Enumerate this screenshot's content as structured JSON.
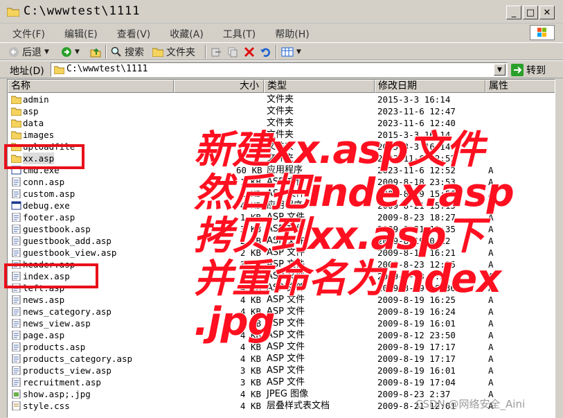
{
  "window": {
    "title": "C:\\wwwtest\\1111"
  },
  "menu": [
    "文件(F)",
    "编辑(E)",
    "查看(V)",
    "收藏(A)",
    "工具(T)",
    "帮助(H)"
  ],
  "toolbar": {
    "back": "后退",
    "search": "搜索",
    "folders": "文件夹"
  },
  "address": {
    "label": "地址(D)",
    "value": "C:\\wwwtest\\1111",
    "go": "转到"
  },
  "columns": {
    "name": "名称",
    "size": "大小",
    "type": "类型",
    "date": "修改日期",
    "attr": "属性"
  },
  "files": [
    {
      "name": "admin",
      "size": "",
      "type": "文件夹",
      "date": "2015-3-3 16:14",
      "attr": "",
      "icon": "folder-icon"
    },
    {
      "name": "asp",
      "size": "",
      "type": "文件夹",
      "date": "2023-11-6 12:47",
      "attr": "",
      "icon": "folder-icon"
    },
    {
      "name": "data",
      "size": "",
      "type": "文件夹",
      "date": "2023-11-6 12:40",
      "attr": "",
      "icon": "folder-icon"
    },
    {
      "name": "images",
      "size": "",
      "type": "文件夹",
      "date": "2015-3-3 16:14",
      "attr": "",
      "icon": "folder-icon"
    },
    {
      "name": "uploadfile",
      "size": "",
      "type": "文件夹",
      "date": "2015-3-3 16:14",
      "attr": "",
      "icon": "folder-icon"
    },
    {
      "name": "xx.asp",
      "size": "",
      "type": "文件夹",
      "date": "2023-11-6 12:52",
      "attr": "",
      "icon": "folder-icon"
    },
    {
      "name": "cmd.exe",
      "size": "60 KB",
      "type": "应用程序",
      "date": "2023-11-6 12:52",
      "attr": "A",
      "icon": "exe-icon"
    },
    {
      "name": "conn.asp",
      "size": "1 KB",
      "type": "ASP 文件",
      "date": "2009-8-18 23:53",
      "attr": "A",
      "icon": "asp-file-icon"
    },
    {
      "name": "custom.asp",
      "size": "1 KB",
      "type": "ASP 文件",
      "date": "2009-8-19 15:56",
      "attr": "A",
      "icon": "asp-file-icon"
    },
    {
      "name": "debug.exe",
      "size": "4 KB",
      "type": "应用程序",
      "date": "2009-8-21 15:15",
      "attr": "A",
      "icon": "exe-icon"
    },
    {
      "name": "footer.asp",
      "size": "1 KB",
      "type": "ASP 文件",
      "date": "2009-8-23 18:27",
      "attr": "A",
      "icon": "asp-file-icon"
    },
    {
      "name": "guestbook.asp",
      "size": "3 KB",
      "type": "ASP 文件",
      "date": "2009-8-21 12:35",
      "attr": "A",
      "icon": "asp-file-icon"
    },
    {
      "name": "guestbook_add.asp",
      "size": "2 KB",
      "type": "ASP 文件",
      "date": "2009-8-19 0:12",
      "attr": "A",
      "icon": "asp-file-icon"
    },
    {
      "name": "guestbook_view.asp",
      "size": "2 KB",
      "type": "ASP 文件",
      "date": "2009-8-19 16:21",
      "attr": "A",
      "icon": "asp-file-icon"
    },
    {
      "name": "header.asp",
      "size": "3 KB",
      "type": "ASP 文件",
      "date": "2009-8-23 12:25",
      "attr": "A",
      "icon": "asp-file-icon"
    },
    {
      "name": "index.asp",
      "size": "4 KB",
      "type": "ASP 文件",
      "date": "2009-8-23 2:37",
      "attr": "A",
      "icon": "asp-file-icon"
    },
    {
      "name": "left.asp",
      "size": "4 KB",
      "type": "ASP 文件",
      "date": "2009-8-19 16:36",
      "attr": "A",
      "icon": "asp-file-icon"
    },
    {
      "name": "news.asp",
      "size": "4 KB",
      "type": "ASP 文件",
      "date": "2009-8-19 16:25",
      "attr": "A",
      "icon": "asp-file-icon"
    },
    {
      "name": "news_category.asp",
      "size": "4 KB",
      "type": "ASP 文件",
      "date": "2009-8-19 16:24",
      "attr": "A",
      "icon": "asp-file-icon"
    },
    {
      "name": "news_view.asp",
      "size": "2 KB",
      "type": "ASP 文件",
      "date": "2009-8-19 16:01",
      "attr": "A",
      "icon": "asp-file-icon"
    },
    {
      "name": "page.asp",
      "size": "4 KB",
      "type": "ASP 文件",
      "date": "2009-8-12 23:50",
      "attr": "A",
      "icon": "asp-file-icon"
    },
    {
      "name": "products.asp",
      "size": "4 KB",
      "type": "ASP 文件",
      "date": "2009-8-19 17:17",
      "attr": "A",
      "icon": "asp-file-icon"
    },
    {
      "name": "products_category.asp",
      "size": "4 KB",
      "type": "ASP 文件",
      "date": "2009-8-19 17:17",
      "attr": "A",
      "icon": "asp-file-icon"
    },
    {
      "name": "products_view.asp",
      "size": "3 KB",
      "type": "ASP 文件",
      "date": "2009-8-19 16:01",
      "attr": "A",
      "icon": "asp-file-icon"
    },
    {
      "name": "recruitment.asp",
      "size": "3 KB",
      "type": "ASP 文件",
      "date": "2009-8-19 17:04",
      "attr": "A",
      "icon": "asp-file-icon"
    },
    {
      "name": "show.asp;.jpg",
      "size": "4 KB",
      "type": "JPEG 图像",
      "date": "2009-8-23 2:37",
      "attr": "A",
      "icon": "jpeg-file-icon"
    },
    {
      "name": "style.css",
      "size": "4 KB",
      "type": "层叠样式表文档",
      "date": "2009-8-21 12:01",
      "attr": "A",
      "icon": "css-file-icon"
    }
  ],
  "overlay": {
    "lines": [
      "新建xx.asp文件",
      "然后把index.asp",
      "拷贝到xx.asp下",
      "并重命名为index",
      ".jpg"
    ],
    "color": "#ff1020"
  },
  "watermark": "CSDN @网络安全_Aini",
  "colors": {
    "chrome": "#d4d0c8",
    "highlight_box": "#e8101a"
  }
}
